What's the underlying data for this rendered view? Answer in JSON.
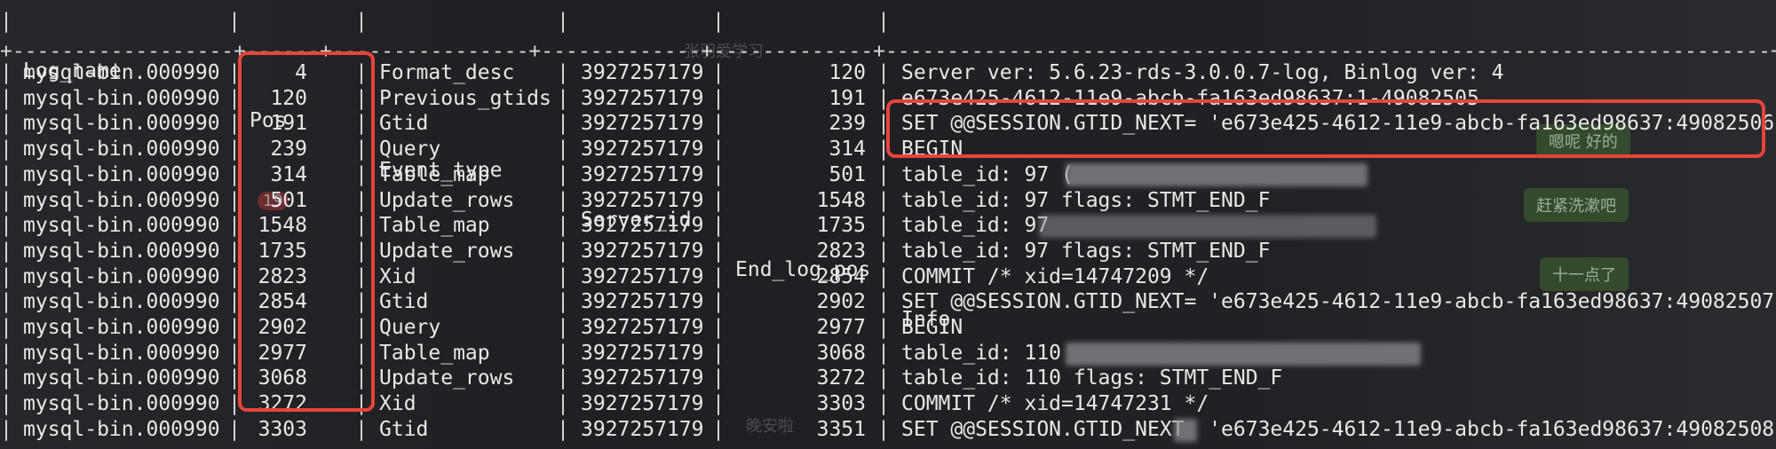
{
  "header": {
    "columns": [
      "Log_name",
      "Pos",
      "Event_type",
      "Server_id",
      "End_log_pos",
      "Info"
    ]
  },
  "separator": "+------------------+------+----------------+-------------+-------------+------------------------------------------------------------------------+",
  "rows": [
    {
      "log_name": "mysql-bin.000990",
      "pos": "4",
      "event_type": "Format_desc",
      "server_id": "3927257179",
      "end_log_pos": "120",
      "info": "Server ver: 5.6.23-rds-3.0.0.7-log, Binlog ver: 4"
    },
    {
      "log_name": "mysql-bin.000990",
      "pos": "120",
      "event_type": "Previous_gtids",
      "server_id": "3927257179",
      "end_log_pos": "191",
      "info": "e673e425-4612-11e9-abcb-fa163ed98637:1-49082505"
    },
    {
      "log_name": "mysql-bin.000990",
      "pos": "191",
      "event_type": "Gtid",
      "server_id": "3927257179",
      "end_log_pos": "239",
      "info": "SET @@SESSION.GTID_NEXT= 'e673e425-4612-11e9-abcb-fa163ed98637:49082506'"
    },
    {
      "log_name": "mysql-bin.000990",
      "pos": "239",
      "event_type": "Query",
      "server_id": "3927257179",
      "end_log_pos": "314",
      "info": "BEGIN"
    },
    {
      "log_name": "mysql-bin.000990",
      "pos": "314",
      "event_type": "Table_map",
      "server_id": "3927257179",
      "end_log_pos": "501",
      "info": "table_id: 97 ("
    },
    {
      "log_name": "mysql-bin.000990",
      "pos": "501",
      "event_type": "Update_rows",
      "server_id": "3927257179",
      "end_log_pos": "1548",
      "info": "table_id: 97 flags: STMT_END_F"
    },
    {
      "log_name": "mysql-bin.000990",
      "pos": "1548",
      "event_type": "Table_map",
      "server_id": "3927257179",
      "end_log_pos": "1735",
      "info": "table_id: 97"
    },
    {
      "log_name": "mysql-bin.000990",
      "pos": "1735",
      "event_type": "Update_rows",
      "server_id": "3927257179",
      "end_log_pos": "2823",
      "info": "table_id: 97 flags: STMT_END_F"
    },
    {
      "log_name": "mysql-bin.000990",
      "pos": "2823",
      "event_type": "Xid",
      "server_id": "3927257179",
      "end_log_pos": "2854",
      "info": "COMMIT /* xid=14747209 */"
    },
    {
      "log_name": "mysql-bin.000990",
      "pos": "2854",
      "event_type": "Gtid",
      "server_id": "3927257179",
      "end_log_pos": "2902",
      "info": "SET @@SESSION.GTID_NEXT= 'e673e425-4612-11e9-abcb-fa163ed98637:49082507'"
    },
    {
      "log_name": "mysql-bin.000990",
      "pos": "2902",
      "event_type": "Query",
      "server_id": "3927257179",
      "end_log_pos": "2977",
      "info": "BEGIN"
    },
    {
      "log_name": "mysql-bin.000990",
      "pos": "2977",
      "event_type": "Table_map",
      "server_id": "3927257179",
      "end_log_pos": "3068",
      "info": "table_id: 110"
    },
    {
      "log_name": "mysql-bin.000990",
      "pos": "3068",
      "event_type": "Update_rows",
      "server_id": "3927257179",
      "end_log_pos": "3272",
      "info": "table_id: 110 flags: STMT_END_F"
    },
    {
      "log_name": "mysql-bin.000990",
      "pos": "3272",
      "event_type": "Xid",
      "server_id": "3927257179",
      "end_log_pos": "3303",
      "info": "COMMIT /* xid=14747231 */"
    },
    {
      "log_name": "mysql-bin.000990",
      "pos": "3303",
      "event_type": "Gtid",
      "server_id": "3927257179",
      "end_log_pos": "3351",
      "info": "SET @@SESSION.GTID_NEXT  'e673e425-4612-11e9-abcb-fa163ed98637:49082508'"
    }
  ],
  "background_chat": {
    "top_message": "张羽爱学习",
    "bubble_1": "嗯呢 好的",
    "bubble_2": "赶紧洗漱吧",
    "bubble_3": "十一点了",
    "bottom_message": "晚安啦",
    "badge": "19"
  },
  "colors": {
    "background": "#1e1f22",
    "text": "#e8e8e8",
    "highlight": "#e8443a"
  }
}
